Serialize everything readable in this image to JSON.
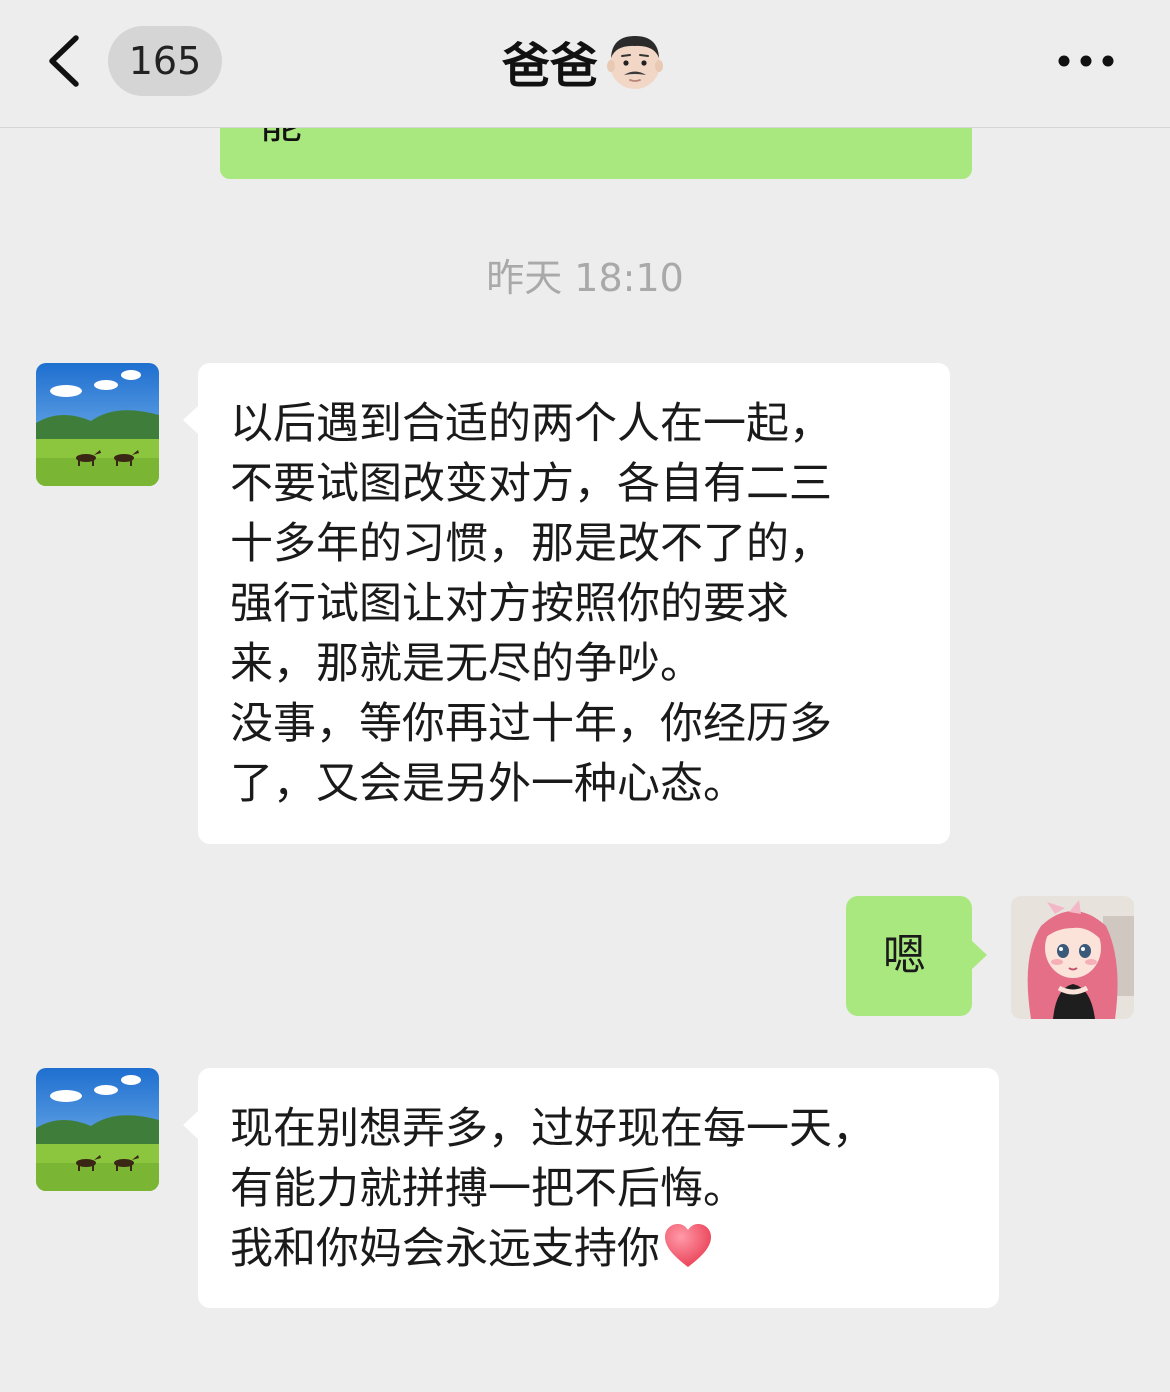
{
  "header": {
    "unread_count": "165",
    "title": "爸爸",
    "title_emoji": "man-emoji"
  },
  "chat": {
    "partial_top_message": "能",
    "timestamp": "昨天 18:10",
    "messages": [
      {
        "from": "dad",
        "lines": [
          "以后遇到合适的两个人在一起，",
          "不要试图改变对方，各自有二三",
          "十多年的习惯，那是改不了的，",
          "强行试图让对方按照你的要求",
          "来，那就是无尽的争吵。",
          "没事，等你再过十年，你经历多",
          "了，又会是另外一种心态。"
        ]
      },
      {
        "from": "me",
        "lines": [
          "嗯"
        ]
      },
      {
        "from": "dad",
        "lines": [
          "现在别想弄多，过好现在每一天，",
          "有能力就拼搏一把不后悔。",
          "我和你妈会永远支持你"
        ],
        "trailing_emoji": "red-heart"
      }
    ]
  },
  "colors": {
    "background": "#ededed",
    "outgoing_bubble": "#a9e87f",
    "incoming_bubble": "#ffffff",
    "timestamp": "#a9a9a9"
  }
}
